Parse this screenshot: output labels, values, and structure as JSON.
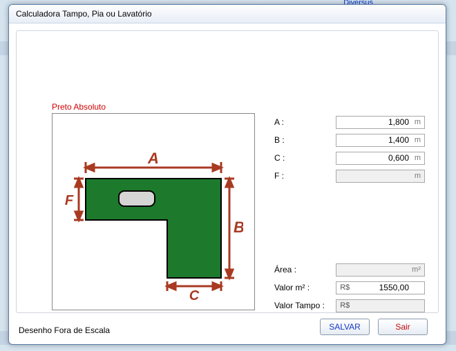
{
  "bg_link_text": "Diversus",
  "window_title": "Calculadora Tampo, Pia ou Lavatório",
  "drawing_title": "Preto Absoluto",
  "dim_labels": {
    "A": "A",
    "B": "B",
    "C": "C",
    "F": "F"
  },
  "inputs": {
    "A": {
      "label": "A :",
      "value": "1,800",
      "unit": "m"
    },
    "B": {
      "label": "B :",
      "value": "1,400",
      "unit": "m"
    },
    "C": {
      "label": "C :",
      "value": "0,600",
      "unit": "m"
    },
    "F": {
      "label": "F :",
      "value": "",
      "unit": "m"
    }
  },
  "results": {
    "area": {
      "label": "Área :",
      "value": "",
      "unit": "m²"
    },
    "valor_m2": {
      "label": "Valor m² :",
      "prefix": "R$",
      "value": "1550,00"
    },
    "valor_tampo": {
      "label": "Valor Tampo :",
      "prefix": "R$",
      "value": ""
    }
  },
  "footer_note": "Desenho Fora de Escala",
  "buttons": {
    "save": "SALVAR",
    "exit": "Sair"
  },
  "colors": {
    "shape_fill": "#1d7a2c",
    "shape_stroke": "#000000",
    "sink_fill": "#d5d5d5",
    "dim_color": "#a83a21"
  }
}
